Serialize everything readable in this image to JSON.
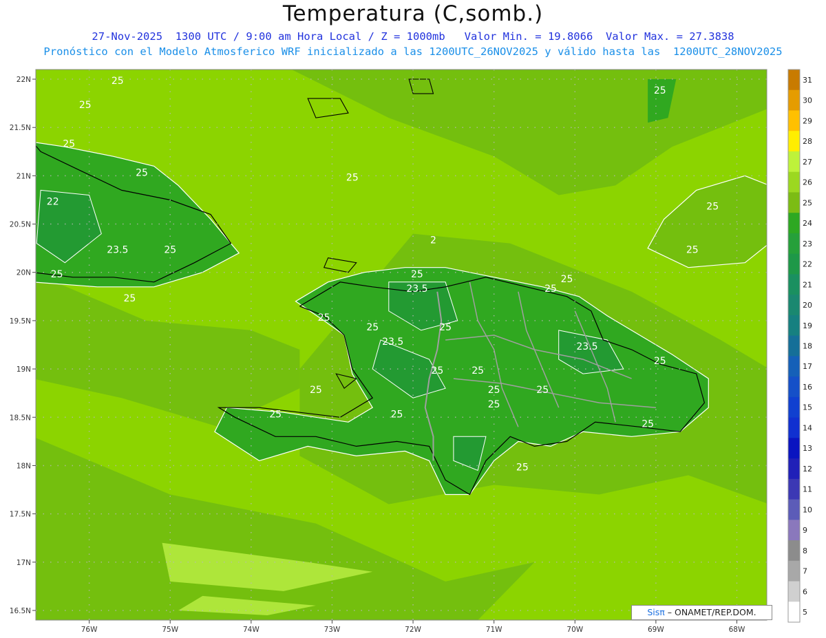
{
  "header": {
    "title": "Temperatura (C,somb.)",
    "line1": "27-Nov-2025  1300 UTC / 9:00 am Hora Local / Z = 1000mb   Valor Min. = 19.8066  Valor Max. = 27.3838",
    "line2": "Pronóstico con el Modelo Atmosferico WRF inicializado a las 1200UTC_26NOV2025 y válido hasta las  1200UTC_28NOV2025"
  },
  "axes": {
    "lat_labels": [
      "22N",
      "21.5N",
      "21N",
      "20.5N",
      "20N",
      "19.5N",
      "19N",
      "18.5N",
      "18N",
      "17.5N",
      "17N",
      "16.5N"
    ],
    "lon_labels": [
      "76W",
      "75W",
      "74W",
      "73W",
      "72W",
      "71W",
      "70W",
      "69W",
      "68W"
    ]
  },
  "colorbar": {
    "labels": [
      "31",
      "30",
      "29",
      "28",
      "27",
      "26",
      "25",
      "24",
      "23",
      "22",
      "21",
      "20",
      "19",
      "18",
      "17",
      "16",
      "15",
      "14",
      "13",
      "12",
      "11",
      "10",
      "9",
      "8",
      "7",
      "6",
      "5"
    ],
    "colors": [
      "#c87b00",
      "#e59c00",
      "#ffc000",
      "#ffee00",
      "#bef23a",
      "#9cd820",
      "#7cbc14",
      "#2ea822",
      "#26a03a",
      "#1e9848",
      "#1a9060",
      "#1a8870",
      "#168080",
      "#156f98",
      "#1560b8",
      "#1550c8",
      "#1040d0",
      "#1030d0",
      "#0a14c0",
      "#2020b8",
      "#3c38b4",
      "#5c5cb8",
      "#8a78bc",
      "#8c8c8c",
      "#a8a8a8",
      "#d0d0d0",
      "#ffffff"
    ]
  },
  "map_colors": {
    "ocean_light": "#8cd400",
    "ocean_mid": "#74bf0e",
    "warm": "#aee63a",
    "land": "#30a820",
    "land_dark": "#1f9638",
    "contour": "#ffffff",
    "coast": "#000000",
    "border": "#a0a0a0"
  },
  "contour_labels": [
    {
      "text": "25",
      "lat": 21.95,
      "lon": -75.65
    },
    {
      "text": "25",
      "lat": 21.7,
      "lon": -76.05
    },
    {
      "text": "25",
      "lat": 21.3,
      "lon": -76.25
    },
    {
      "text": "25",
      "lat": 21.0,
      "lon": -75.35
    },
    {
      "text": "22",
      "lat": 20.7,
      "lon": -76.45
    },
    {
      "text": "23.5",
      "lat": 20.2,
      "lon": -75.65
    },
    {
      "text": "25",
      "lat": 20.2,
      "lon": -75.0
    },
    {
      "text": "25",
      "lat": 19.95,
      "lon": -76.4
    },
    {
      "text": "25",
      "lat": 19.7,
      "lon": -75.5
    },
    {
      "text": "25",
      "lat": 20.95,
      "lon": -72.75
    },
    {
      "text": "25",
      "lat": 21.85,
      "lon": -68.95
    },
    {
      "text": "25",
      "lat": 20.65,
      "lon": -68.3
    },
    {
      "text": "25",
      "lat": 20.2,
      "lon": -68.55
    },
    {
      "text": "2",
      "lat": 20.3,
      "lon": -71.75
    },
    {
      "text": "25",
      "lat": 19.95,
      "lon": -71.95
    },
    {
      "text": "23.5",
      "lat": 19.8,
      "lon": -71.95
    },
    {
      "text": "25",
      "lat": 19.9,
      "lon": -70.1
    },
    {
      "text": "25",
      "lat": 19.8,
      "lon": -70.3
    },
    {
      "text": "25",
      "lat": 19.5,
      "lon": -73.1
    },
    {
      "text": "25",
      "lat": 19.4,
      "lon": -72.5
    },
    {
      "text": "23.5",
      "lat": 19.25,
      "lon": -72.25
    },
    {
      "text": "25",
      "lat": 19.4,
      "lon": -71.6
    },
    {
      "text": "23.5",
      "lat": 19.2,
      "lon": -69.85
    },
    {
      "text": "25",
      "lat": 19.05,
      "lon": -68.95
    },
    {
      "text": "25",
      "lat": 18.95,
      "lon": -71.7
    },
    {
      "text": "25",
      "lat": 18.95,
      "lon": -71.2
    },
    {
      "text": "25",
      "lat": 18.75,
      "lon": -73.2
    },
    {
      "text": "25",
      "lat": 18.75,
      "lon": -70.4
    },
    {
      "text": "25",
      "lat": 18.75,
      "lon": -71.0
    },
    {
      "text": "25",
      "lat": 18.6,
      "lon": -71.0
    },
    {
      "text": "25",
      "lat": 18.5,
      "lon": -72.2
    },
    {
      "text": "25",
      "lat": 18.5,
      "lon": -73.7
    },
    {
      "text": "25",
      "lat": 18.4,
      "lon": -69.1
    },
    {
      "text": "25",
      "lat": 17.95,
      "lon": -70.65
    }
  ],
  "credit": {
    "brand": "Sisπ",
    "text": " – ONAMET/REP.DOM."
  }
}
